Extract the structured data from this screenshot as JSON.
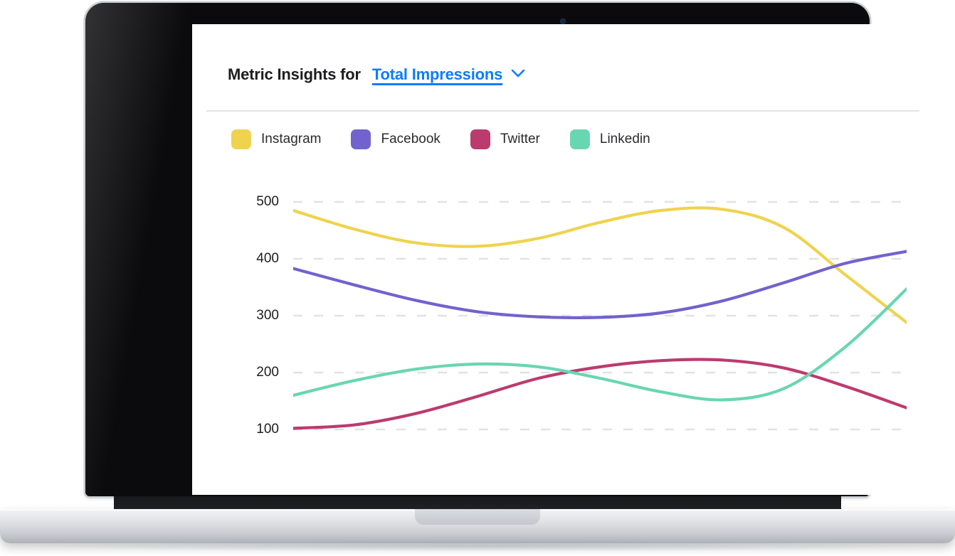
{
  "header": {
    "title_static": "Metric Insights for",
    "metric_selected": "Total Impressions",
    "chevron_icon": "chevron-down-icon",
    "link_color": "#0a7cff"
  },
  "legend": [
    {
      "label": "Instagram",
      "color": "#efd34f"
    },
    {
      "label": "Facebook",
      "color": "#7262ce"
    },
    {
      "label": "Twitter",
      "color": "#bc3b6e"
    },
    {
      "label": "Linkedin",
      "color": "#69d6b2"
    }
  ],
  "chart_data": {
    "type": "line",
    "title": "Metric Insights for Total Impressions",
    "xlabel": "",
    "ylabel": "",
    "ylim": [
      50,
      550
    ],
    "yticks": [
      500,
      400,
      300,
      200,
      100
    ],
    "grid": "horizontal-dashed",
    "legend_position": "top-left",
    "x": [
      0,
      1,
      2,
      3,
      4,
      5,
      6,
      7,
      8,
      9,
      10
    ],
    "series": [
      {
        "name": "Instagram",
        "color": "#efd34f",
        "values": [
          485,
          452,
          428,
          422,
          436,
          464,
          485,
          487,
          455,
          372,
          288
        ]
      },
      {
        "name": "Facebook",
        "color": "#7262ce",
        "values": [
          383,
          354,
          327,
          307,
          298,
          297,
          305,
          326,
          358,
          392,
          413
        ]
      },
      {
        "name": "Twitter",
        "color": "#bc3b6e",
        "values": [
          102,
          108,
          128,
          158,
          190,
          210,
          221,
          222,
          208,
          176,
          138
        ]
      },
      {
        "name": "Linkedin",
        "color": "#69d6b2",
        "values": [
          160,
          186,
          206,
          215,
          210,
          190,
          166,
          152,
          172,
          245,
          347
        ]
      }
    ]
  }
}
